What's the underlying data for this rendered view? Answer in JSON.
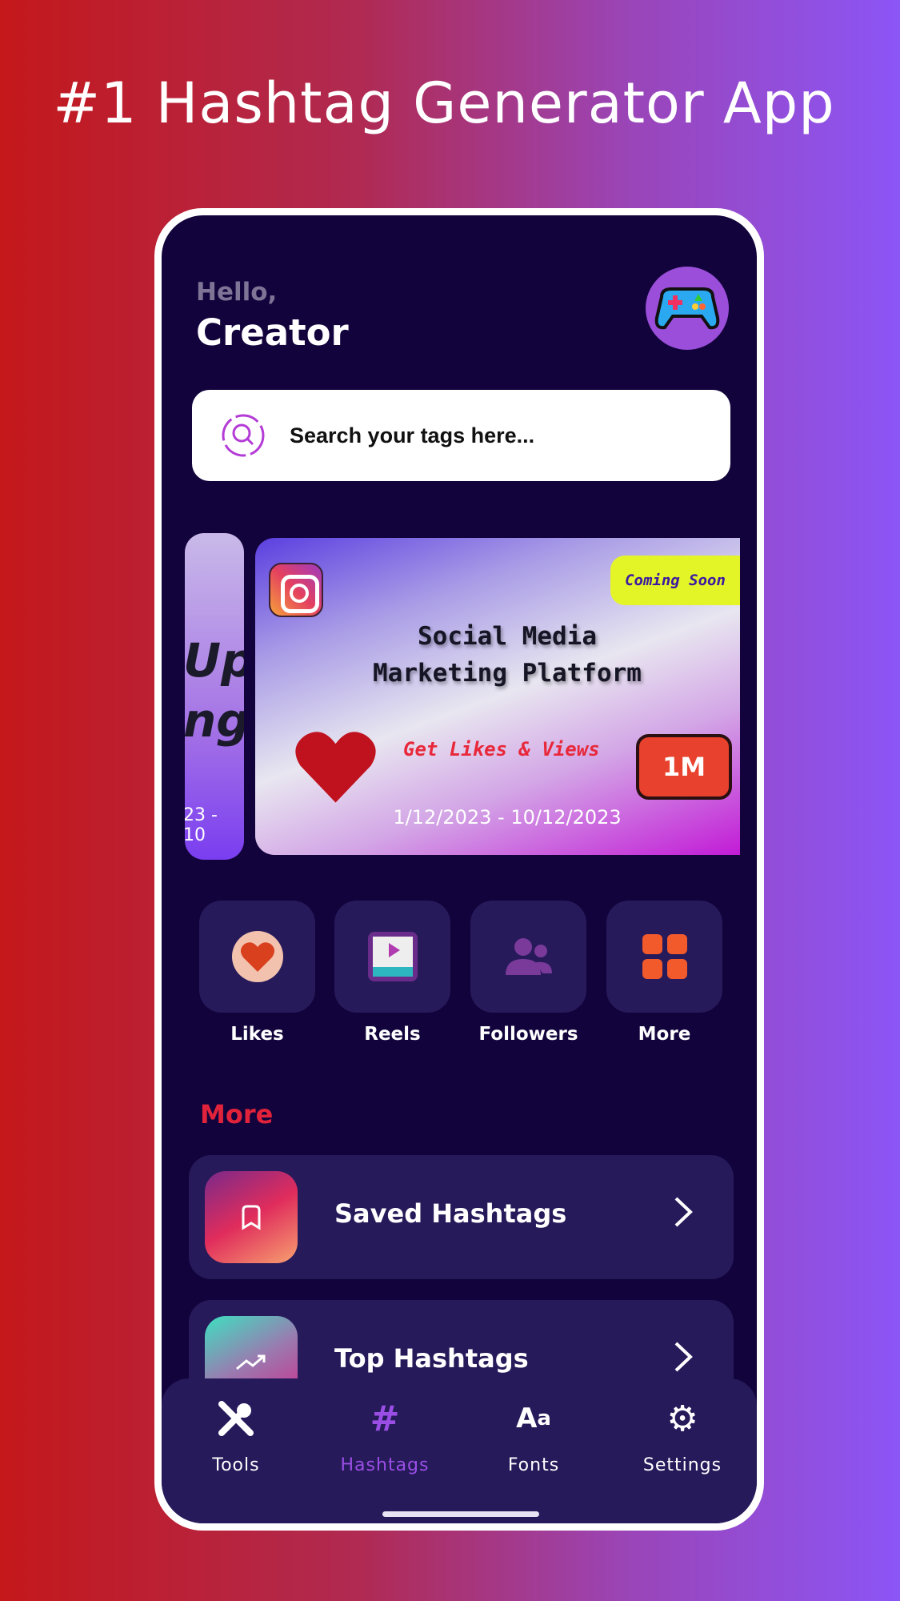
{
  "headline": "#1 Hashtag Generator App",
  "header": {
    "greeting": "Hello,",
    "name": "Creator",
    "avatar_icon": "gamepad-icon"
  },
  "search": {
    "placeholder": "Search your tags here..."
  },
  "carousel": {
    "peek": {
      "line1": "Upc",
      "line2": "ng",
      "dates": "23 - 10"
    },
    "banner": {
      "badge": "Coming Soon",
      "title_line1": "Social Media",
      "title_line2": "Marketing Platform",
      "tagline": "Get Likes & Views",
      "count_badge": "1M",
      "dates": "1/12/2023 - 10/12/2023"
    }
  },
  "quick_actions": [
    {
      "label": "Likes",
      "icon": "heart-icon"
    },
    {
      "label": "Reels",
      "icon": "video-play-icon"
    },
    {
      "label": "Followers",
      "icon": "users-icon"
    },
    {
      "label": "More",
      "icon": "grid-icon"
    }
  ],
  "more_section": {
    "title": "More",
    "items": [
      {
        "label": "Saved Hashtags",
        "icon": "bookmark-icon"
      },
      {
        "label": "Top Hashtags",
        "icon": "trending-up-icon"
      }
    ]
  },
  "bottom_nav": {
    "active": "Hashtags",
    "items": [
      {
        "label": "Tools",
        "icon": "tools-icon"
      },
      {
        "label": "Hashtags",
        "icon": "hashtag-icon"
      },
      {
        "label": "Fonts",
        "icon": "font-icon"
      },
      {
        "label": "Settings",
        "icon": "gear-icon"
      }
    ]
  },
  "colors": {
    "accent": "#9b4ee6",
    "background": "#12033c",
    "card": "#261a5a",
    "section_title": "#e0233a"
  }
}
